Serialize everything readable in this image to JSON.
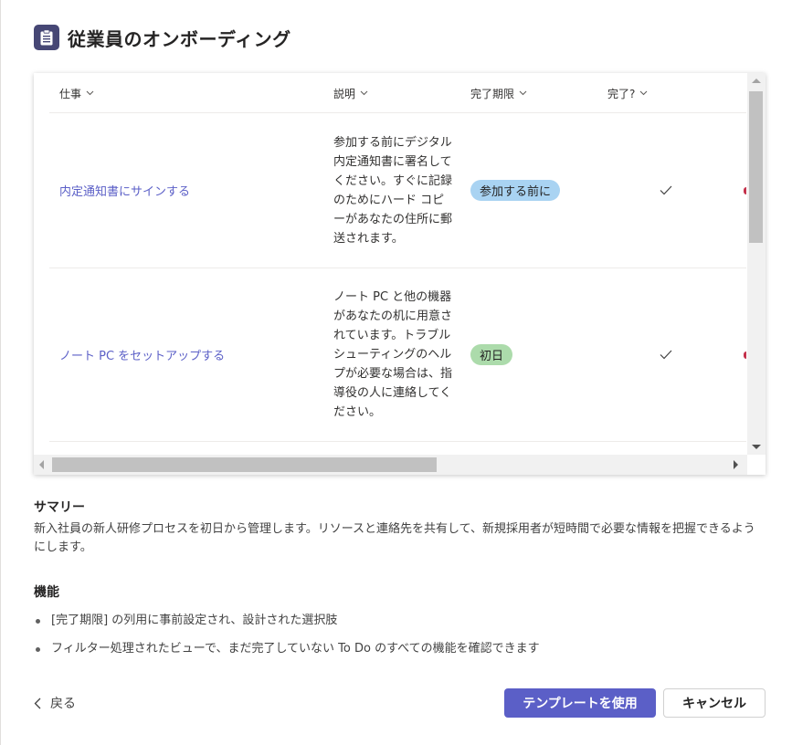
{
  "dialog": {
    "title": "従業員のオンボーディング",
    "icon": "clipboard-list-icon"
  },
  "preview": {
    "columns": [
      {
        "label": "仕事"
      },
      {
        "label": "説明"
      },
      {
        "label": "完了期限"
      },
      {
        "label": "完了?"
      }
    ],
    "rows": [
      {
        "task": "内定通知書にサインする",
        "description": "参加する前にデジタル内定通知書に署名してください。すぐに記録のためにハード コピーがあなたの住所に郵送されます。",
        "due": "参加する前に",
        "due_color": "#a9d3f2",
        "done": true
      },
      {
        "task": "ノート PC をセットアップする",
        "description": "ノート PC と他の機器があなたの机に用意されています。トラブルシューティングのヘルプが必要な場合は、指導役の人に連絡してください。",
        "due": "初日",
        "due_color": "#acdbab",
        "done": true
      }
    ]
  },
  "summary": {
    "title": "サマリー",
    "text": "新入社員の新人研修プロセスを初日から管理します。リソースと連絡先を共有して、新規採用者が短時間で必要な情報を把握できるようにします。"
  },
  "features": {
    "title": "機能",
    "items": [
      "[完了期限] の列用に事前設定され、設計された選択肢",
      "フィルター処理されたビューで、まだ完了していない To Do のすべての機能を確認できます"
    ]
  },
  "footer": {
    "back_label": "戻る",
    "use_template_label": "テンプレートを使用",
    "cancel_label": "キャンセル",
    "accent_color": "#5b5fc7"
  }
}
